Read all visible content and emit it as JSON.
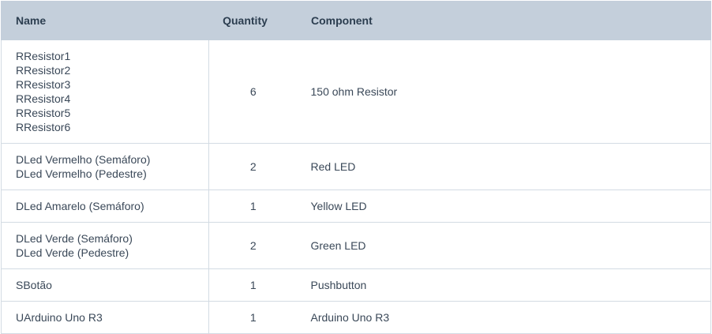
{
  "table": {
    "headers": {
      "name": "Name",
      "quantity": "Quantity",
      "component": "Component"
    },
    "rows": [
      {
        "names": [
          "RResistor1",
          "RResistor2",
          "RResistor3",
          "RResistor4",
          "RResistor5",
          "RResistor6"
        ],
        "quantity": "6",
        "component": "150 ohm Resistor"
      },
      {
        "names": [
          "DLed Vermelho (Semáforo)",
          "DLed Vermelho (Pedestre)"
        ],
        "quantity": "2",
        "component": "Red LED"
      },
      {
        "names": [
          "DLed Amarelo (Semáforo)"
        ],
        "quantity": "1",
        "component": "Yellow LED"
      },
      {
        "names": [
          "DLed Verde (Semáforo)",
          "DLed Verde (Pedestre)"
        ],
        "quantity": "2",
        "component": "Green LED"
      },
      {
        "names": [
          "SBotão"
        ],
        "quantity": "1",
        "component": "Pushbutton"
      },
      {
        "names": [
          "UArduino Uno R3"
        ],
        "quantity": "1",
        "component": "Arduino Uno R3"
      }
    ]
  }
}
